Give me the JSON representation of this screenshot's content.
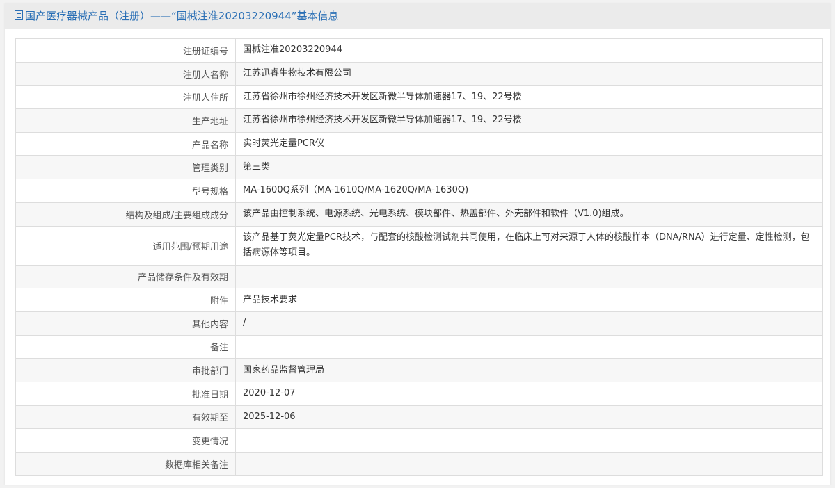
{
  "header": {
    "title": "国产医疗器械产品（注册）——“国械注准20203220944”基本信息"
  },
  "rows": [
    {
      "label": "注册证编号",
      "value": "国械注准20203220944"
    },
    {
      "label": "注册人名称",
      "value": "江苏迅睿生物技术有限公司"
    },
    {
      "label": "注册人住所",
      "value": "江苏省徐州市徐州经济技术开发区新微半导体加速器17、19、22号楼"
    },
    {
      "label": "生产地址",
      "value": "江苏省徐州市徐州经济技术开发区新微半导体加速器17、19、22号楼"
    },
    {
      "label": "产品名称",
      "value": "实时荧光定量PCR仪"
    },
    {
      "label": "管理类别",
      "value": "第三类"
    },
    {
      "label": "型号规格",
      "value": "MA-1600Q系列（MA-1610Q/MA-1620Q/MA-1630Q)"
    },
    {
      "label": "结构及组成/主要组成成分",
      "value": "该产品由控制系统、电源系统、光电系统、模块部件、热盖部件、外壳部件和软件（V1.0)组成。"
    },
    {
      "label": "适用范围/预期用途",
      "value": "该产品基于荧光定量PCR技术，与配套的核酸检测试剂共同使用，在临床上可对来源于人体的核酸样本（DNA/RNA）进行定量、定性检测，包括病源体等项目。"
    },
    {
      "label": "产品储存条件及有效期",
      "value": ""
    },
    {
      "label": "附件",
      "value": "产品技术要求"
    },
    {
      "label": "其他内容",
      "value": "/"
    },
    {
      "label": "备注",
      "value": ""
    },
    {
      "label": "审批部门",
      "value": "国家药品监督管理局"
    },
    {
      "label": "批准日期",
      "value": "2020-12-07"
    },
    {
      "label": "有效期至",
      "value": "2025-12-06"
    },
    {
      "label": "变更情况",
      "value": ""
    },
    {
      "label": "数据库相关备注",
      "value": ""
    }
  ]
}
